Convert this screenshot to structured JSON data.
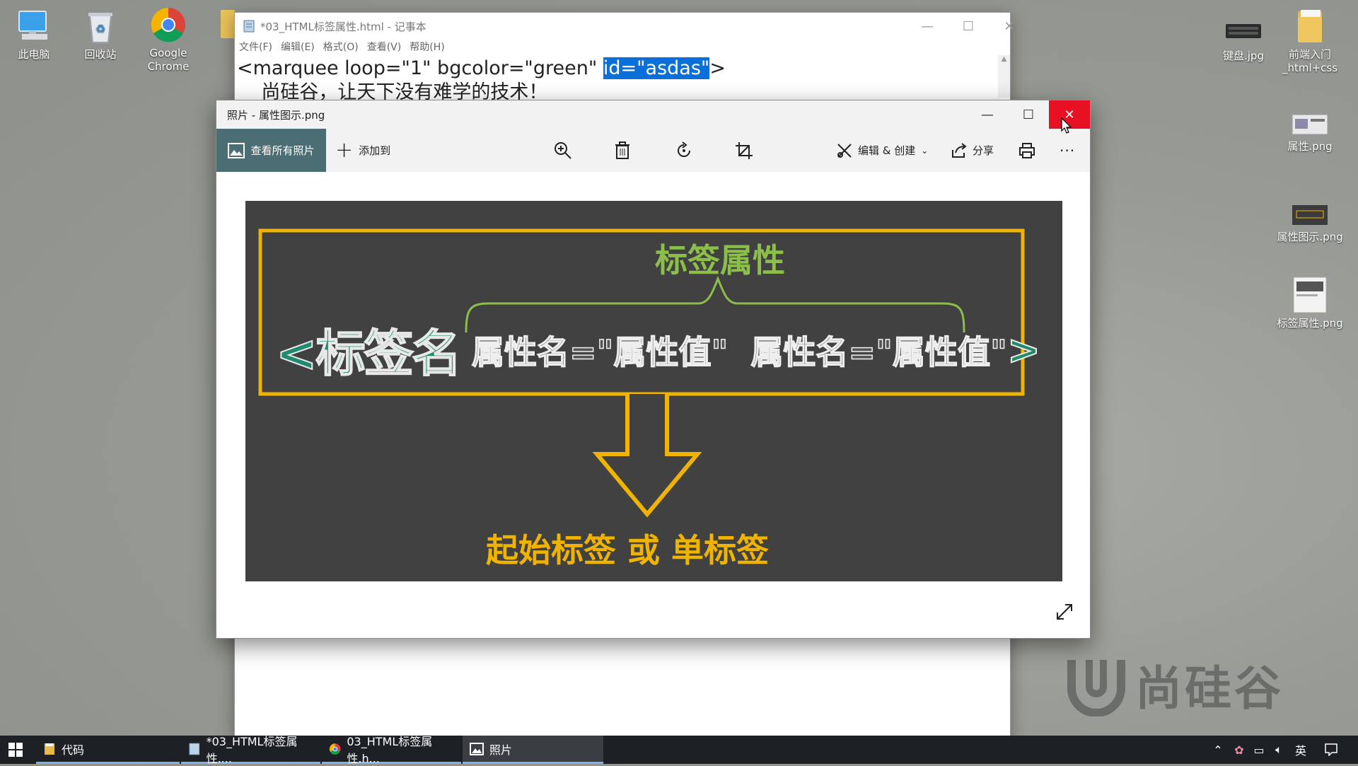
{
  "desktop": {
    "icons_left": [
      {
        "label": "此电脑",
        "icon": "this-pc-icon"
      },
      {
        "label": "回收站",
        "icon": "recycle-bin-icon"
      },
      {
        "label": "Google Chrome",
        "icon": "chrome-icon"
      }
    ],
    "icons_right": [
      {
        "label": "键盘.jpg",
        "icon": "image-file-icon"
      },
      {
        "label": "前端入门_html+css",
        "icon": "folder-icon"
      },
      {
        "label": "属性.png",
        "icon": "image-file-icon"
      },
      {
        "label": "属性图示.png",
        "icon": "image-file-icon"
      },
      {
        "label": "标签属性.png",
        "icon": "image-file-icon"
      }
    ],
    "watermark": "尚硅谷"
  },
  "notepad": {
    "title": "*03_HTML标签属性.html - 记事本",
    "menu": [
      "文件(F)",
      "编辑(E)",
      "格式(O)",
      "查看(V)",
      "帮助(H)"
    ],
    "line1_before": "<marquee loop=\"1\" bgcolor=\"green\" ",
    "line1_selected": "id=\"asdas\"",
    "line1_after": ">",
    "line2": "    尚硅谷，让天下没有难学的技术！"
  },
  "photos": {
    "title": "照片 - 属性图示.png",
    "toolbar": {
      "view_all": "查看所有照片",
      "add_to": "添加到",
      "edit_create": "编辑 & 创建",
      "share": "分享"
    },
    "image": {
      "heading": "标签属性",
      "tag_name": "<标签名",
      "attrs": "属性名=\"属性值\"  属性名=\"属性值\"",
      "close_bracket": ">",
      "caption": "起始标签 或 单标签",
      "colors": {
        "box": "#f0b400",
        "green": "#8bbf4a",
        "teal": "#1f8a6e",
        "bg": "#414141"
      }
    }
  },
  "taskbar": {
    "items": [
      {
        "label": "代码",
        "icon": "folder-icon"
      },
      {
        "label": "*03_HTML标签属性....",
        "icon": "notepad-icon"
      },
      {
        "label": "03_HTML标签属性.h...",
        "icon": "chrome-icon"
      },
      {
        "label": "照片",
        "icon": "photos-icon"
      }
    ],
    "ime": "英"
  }
}
